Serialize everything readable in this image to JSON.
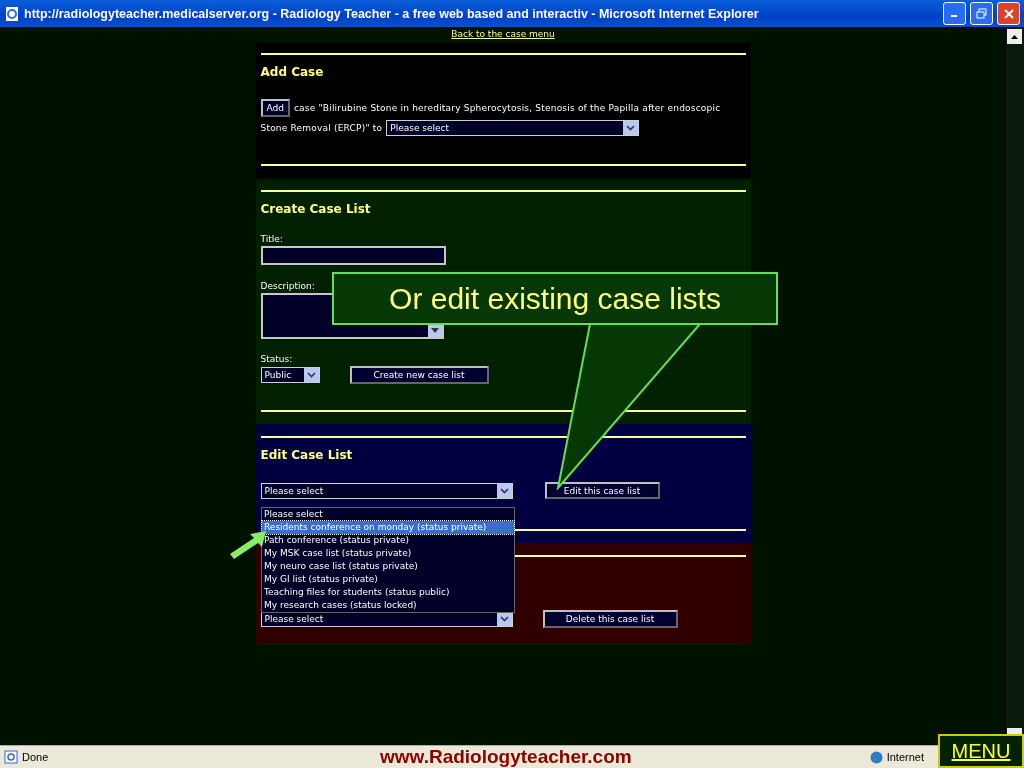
{
  "window": {
    "title": "http://radiologyteacher.medicalserver.org - Radiology Teacher - a free web based and interactiv - Microsoft Internet Explorer"
  },
  "back_link": "Back to the case menu",
  "add_case": {
    "heading": "Add Case",
    "button": "Add",
    "sentence_lines": [
      "case \"Bilirubine Stone in hereditary Spherocytosis, Stenosis of the Papilla after endoscopic",
      "Stone Removal (ERCP)\" to"
    ],
    "select": "Please select"
  },
  "create_case_list": {
    "heading": "Create Case List",
    "title_label": "Title:",
    "description_label": "Description:",
    "status_label": "Status:",
    "status_value": "Public",
    "button": "Create new case list"
  },
  "edit_case_list": {
    "heading": "Edit Case List",
    "select": "Please select",
    "button": "Edit this case list",
    "options": [
      {
        "label": "Please select",
        "selected": false
      },
      {
        "label": "Residents conference on monday (status private)",
        "selected": true
      },
      {
        "label": "Path conference (status private)",
        "selected": false
      },
      {
        "label": "My MSK case list (status private)",
        "selected": false
      },
      {
        "label": "My neuro case list (status private)",
        "selected": false
      },
      {
        "label": "My GI list (status private)",
        "selected": false
      },
      {
        "label": "Teaching files for students (status public)",
        "selected": false
      },
      {
        "label": "My research cases (status locked)",
        "selected": false
      }
    ]
  },
  "delete_case_list": {
    "select": "Please select",
    "button": "Delete this case list"
  },
  "callout": "Or edit existing case lists",
  "status_bar": {
    "status": "Done",
    "zone": "Internet"
  },
  "site_caption": "www.Radiologyteacher.com",
  "menu_button": "MENU"
}
